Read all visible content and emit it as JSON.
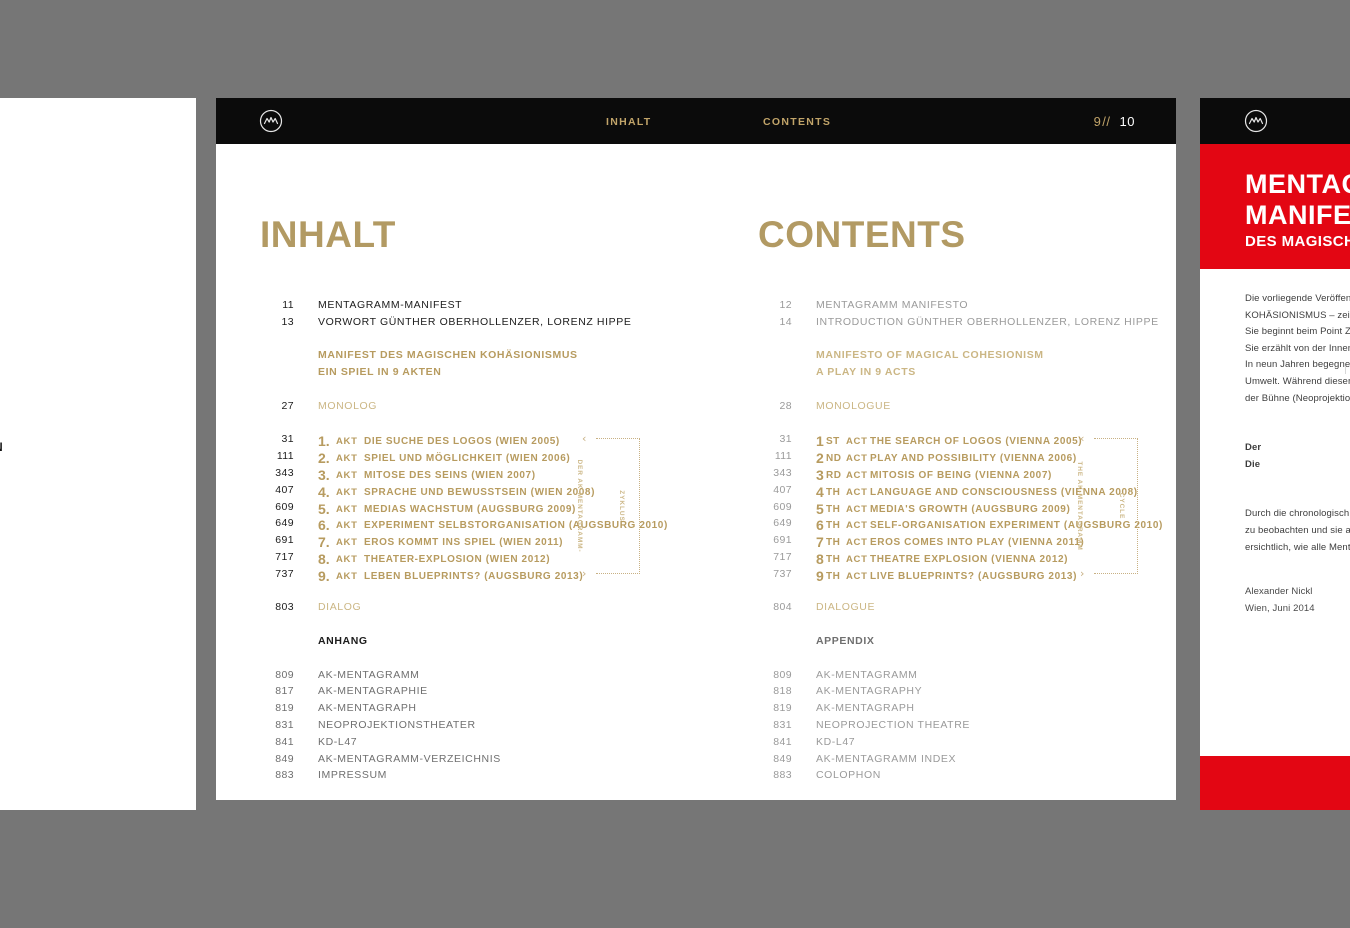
{
  "theme": {
    "gold": "#b79b5f",
    "gold_light": "#cbb684",
    "red": "#e30613",
    "black": "#0b0b0b",
    "ink": "#1c1c1c",
    "gray": "#9a9a9a"
  },
  "left_page": {
    "fragment": "N"
  },
  "spread": {
    "header": {
      "logo_icon": "mentagramm-circle-logo",
      "runhead_de": "INHALT",
      "runhead_en": "CONTENTS",
      "folio_left": "9",
      "folio_separator": "//",
      "folio_right": "10"
    },
    "german": {
      "title": "INHALT",
      "front": [
        {
          "page": "11",
          "text": "MENTAGRAMM-MANIFEST"
        },
        {
          "page": "13",
          "text": "VORWORT GÜNTHER OBERHOLLENZER, LORENZ HIPPE"
        }
      ],
      "section_heading": [
        "MANIFEST DES MAGISCHEN KOHÄSIONISMUS",
        "EIN SPIEL IN 9 AKTEN"
      ],
      "monolog": {
        "page": "27",
        "text": "MONOLOG"
      },
      "acts": [
        {
          "page": "31",
          "num": "1.",
          "label": "AKT",
          "title": "DIE SUCHE DES LOGOS (WIEN 2005)"
        },
        {
          "page": "111",
          "num": "2.",
          "label": "AKT",
          "title": "SPIEL UND MÖGLICHKEIT (WIEN 2006)"
        },
        {
          "page": "343",
          "num": "3.",
          "label": "AKT",
          "title": "MITOSE DES SEINS (WIEN 2007)"
        },
        {
          "page": "407",
          "num": "4.",
          "label": "AKT",
          "title": "SPRACHE UND BEWUSSTSEIN (WIEN 2008)"
        },
        {
          "page": "609",
          "num": "5.",
          "label": "AKT",
          "title": "MEDIAS WACHSTUM (AUGSBURG 2009)"
        },
        {
          "page": "649",
          "num": "6.",
          "label": "AKT",
          "title": "EXPERIMENT SELBSTORGANISATION (AUGSBURG 2010)"
        },
        {
          "page": "691",
          "num": "7.",
          "label": "AKT",
          "title": "EROS KOMMT INS SPIEL (WIEN 2011)"
        },
        {
          "page": "717",
          "num": "8.",
          "label": "AKT",
          "title": "THEATER-EXPLOSION (WIEN 2012)"
        },
        {
          "page": "737",
          "num": "9.",
          "label": "AKT",
          "title": "LEBEN BLUEPRINTS? (AUGSBURG 2013)"
        }
      ],
      "cycle_label_line1": "DER AK-MENTAGRAMM-",
      "cycle_label_line2": "ZYKLUS",
      "dialog": {
        "page": "803",
        "text": "DIALOG"
      },
      "appendix_heading": "ANHANG",
      "appendix": [
        {
          "page": "809",
          "text": "AK-MENTAGRAMM"
        },
        {
          "page": "817",
          "text": "AK-MENTAGRAPHIE"
        },
        {
          "page": "819",
          "text": "AK-MENTAGRAPH"
        },
        {
          "page": "831",
          "text": "NEOPROJEKTIONSTHEATER"
        },
        {
          "page": "841",
          "text": "KD-L47"
        },
        {
          "page": "849",
          "text": "AK-MENTAGRAMM-VERZEICHNIS"
        },
        {
          "page": "883",
          "text": "IMPRESSUM"
        }
      ]
    },
    "english": {
      "title": "CONTENTS",
      "front": [
        {
          "page": "12",
          "text": "MENTAGRAMM MANIFESTO"
        },
        {
          "page": "14",
          "text": "INTRODUCTION GÜNTHER OBERHOLLENZER, LORENZ HIPPE"
        }
      ],
      "section_heading": [
        "MANIFESTO OF MAGICAL COHESIONISM",
        "A PLAY IN 9 ACTS"
      ],
      "monolog": {
        "page": "28",
        "text": "MONOLOGUE"
      },
      "acts": [
        {
          "page": "31",
          "num": "1",
          "ord": "ST",
          "label": "ACT",
          "title": "THE SEARCH OF LOGOS (VIENNA 2005)"
        },
        {
          "page": "111",
          "num": "2",
          "ord": "ND",
          "label": "ACT",
          "title": "PLAY AND POSSIBILITY (VIENNA 2006)"
        },
        {
          "page": "343",
          "num": "3",
          "ord": "RD",
          "label": "ACT",
          "title": "MITOSIS OF BEING (VIENNA 2007)"
        },
        {
          "page": "407",
          "num": "4",
          "ord": "TH",
          "label": "ACT",
          "title": "LANGUAGE AND CONSCIOUSNESS (VIENNA 2008)"
        },
        {
          "page": "609",
          "num": "5",
          "ord": "TH",
          "label": "ACT",
          "title": "MEDIA'S GROWTH (AUGSBURG 2009)"
        },
        {
          "page": "649",
          "num": "6",
          "ord": "TH",
          "label": "ACT",
          "title": "SELF-ORGANISATION EXPERIMENT (AUGSBURG 2010)"
        },
        {
          "page": "691",
          "num": "7",
          "ord": "TH",
          "label": "ACT",
          "title": "EROS COMES INTO PLAY (VIENNA 2011)"
        },
        {
          "page": "717",
          "num": "8",
          "ord": "TH",
          "label": "ACT",
          "title": "THEATRE EXPLOSION (VIENNA 2012)"
        },
        {
          "page": "737",
          "num": "9",
          "ord": "TH",
          "label": "ACT",
          "title": "LIVE BLUEPRINTS? (AUGSBURG 2013)"
        }
      ],
      "cycle_label_line1": "THE AK-MENTAGRAMM",
      "cycle_label_line2": "CYCLE",
      "dialog": {
        "page": "804",
        "text": "DIALOGUE"
      },
      "appendix_heading": "APPENDIX",
      "appendix": [
        {
          "page": "809",
          "text": "AK-MENTAGRAMM"
        },
        {
          "page": "818",
          "text": "AK-MENTAGRAPHY"
        },
        {
          "page": "819",
          "text": "AK-MENTAGRAPH"
        },
        {
          "page": "831",
          "text": "NEOPROJECTION THEATRE"
        },
        {
          "page": "841",
          "text": "KD-L47"
        },
        {
          "page": "849",
          "text": "AK-MENTAGRAMM INDEX"
        },
        {
          "page": "883",
          "text": "COLOPHON"
        }
      ]
    },
    "bracket_arrow_top": "‹",
    "bracket_arrow_bottom": "›"
  },
  "right_page": {
    "logo_icon": "mentagramm-circle-logo",
    "banner": {
      "line1": "MENTAG",
      "line2": "MANIFE",
      "line3": "DES MAGISCHE"
    },
    "paragraph1": [
      "Die vorliegende Veröffent",
      "KOHÄSIONISMUS – zeigt",
      "Sie beginnt beim Point Ze",
      "Sie erzählt von der Innen",
      "In neun Jahren begegne",
      "Umwelt. Während dieser",
      "der Bühne (Neoprojektio"
    ],
    "centered": [
      "Der",
      "Die"
    ],
    "paragraph2": [
      "Durch die chronologisch",
      "zu beobachten und sie al",
      "ersichtlich, wie alle Ment"
    ],
    "signature": [
      "Alexander Nickl",
      "Wien, Juni 2014"
    ]
  }
}
